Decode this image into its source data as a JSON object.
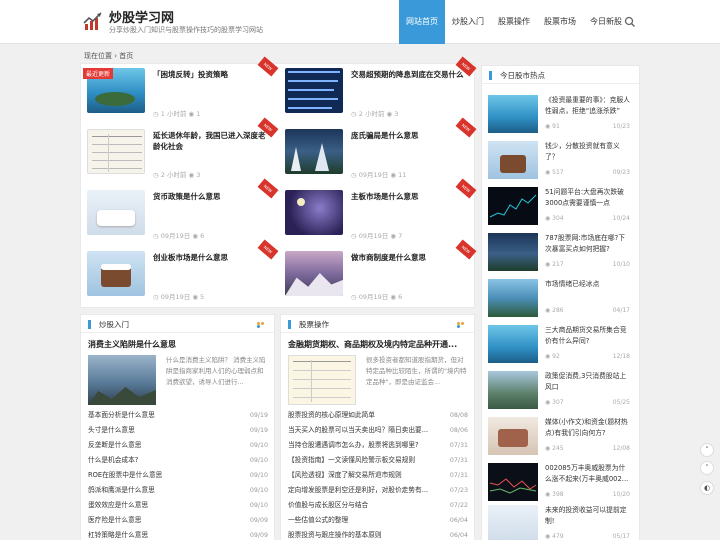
{
  "site": {
    "title": "炒股学习网",
    "subtitle": "分享炒股入门知识与股票操作技巧的股票学习网站"
  },
  "nav": [
    "网站首页",
    "炒股入门",
    "股票操作",
    "股票市场",
    "今日新股"
  ],
  "breadcrumb": "现在位置 › 首页",
  "ribbon": "NEW",
  "latest_tag": "最近更新",
  "cards": [
    {
      "title": "「困境反转」投资策略",
      "time": "1 小时前",
      "views": "1"
    },
    {
      "title": "交易超预期的降息到底在交易什么",
      "time": "2 小时前",
      "views": "3"
    },
    {
      "title": "延长退休年龄，我国已进入深度老龄化社会",
      "time": "2 小时前",
      "views": "3"
    },
    {
      "title": "庞氏骗局是什么意思",
      "time": "09月19日",
      "views": "11"
    },
    {
      "title": "货币政策是什么意思",
      "time": "09月19日",
      "views": "6"
    },
    {
      "title": "主板市场是什么意思",
      "time": "09月19日",
      "views": "7"
    },
    {
      "title": "创业板市场是什么意思",
      "time": "09月19日",
      "views": "5"
    },
    {
      "title": "做市商制度是什么意思",
      "time": "09月19日",
      "views": "6"
    }
  ],
  "section_left": {
    "label": "炒股入门",
    "featured_title": "消费主义陷阱是什么意思",
    "featured_desc": "什么是消费主义陷阱？ 消费主义陷阱是指商家利用人们的心理弱点和消费欲望，诱导人们进行...",
    "items": [
      {
        "t": "基本面分析是什么意思",
        "d": "09/19"
      },
      {
        "t": "头寸是什么意思",
        "d": "09/19"
      },
      {
        "t": "反垄断是什么意思",
        "d": "09/10"
      },
      {
        "t": "什么是机会成本?",
        "d": "09/10"
      },
      {
        "t": "ROE在股票中是什么意思",
        "d": "09/10"
      },
      {
        "t": "鸽派和鹰派是什么意思",
        "d": "09/10"
      },
      {
        "t": "蛋效效应是什么意思",
        "d": "09/10"
      },
      {
        "t": "医疗险是什么意思",
        "d": "09/09"
      },
      {
        "t": "杠铃策略是什么意思",
        "d": "09/09"
      }
    ]
  },
  "section_right": {
    "label": "股票操作",
    "featured_title": "金融期货期权、商品期权及境内特定品种开通...",
    "featured_desc": "很多投资者都知道股指期货，但对特定品种比较陌生，所谓的\"境内特定品种\"，即是由证监会...",
    "items": [
      {
        "t": "股票投资的核心原理如此简单",
        "d": "08/08"
      },
      {
        "t": "当天买入的股票可以当天卖出吗？隔日卖出要...",
        "d": "08/06"
      },
      {
        "t": "当持仓股遭遇调市怎么办，股票将逃到哪里?",
        "d": "07/31"
      },
      {
        "t": "【投资指南】一文读懂风险警示板交易规则",
        "d": "07/31"
      },
      {
        "t": "【风险透视】深度了解交易所退市规则",
        "d": "07/31"
      },
      {
        "t": "定向增发股票是利空还是利好，对股价走势有...",
        "d": "07/23"
      },
      {
        "t": "价值股与成长股区分与结合",
        "d": "07/22"
      },
      {
        "t": "一些估值公式的整理",
        "d": "06/04"
      },
      {
        "t": "股票投资与跟庄操作的基本原则",
        "d": "06/04"
      }
    ]
  },
  "sidebar": {
    "label": "今日股市热点",
    "items": [
      {
        "t": "《投资最重要的事》：克服人性弱点，拒绝“追涨杀跌”",
        "v": "91",
        "d": "10/23"
      },
      {
        "t": "钱少，分散投资就有意义了？",
        "v": "517",
        "d": "09/23"
      },
      {
        "t": "51问题平台:大盘再次跌破3000点需要谨慎一点",
        "v": "304",
        "d": "10/24"
      },
      {
        "t": "787股票网:市场底在哪?下次暴富买点如何把握?",
        "v": "217",
        "d": "10/10"
      },
      {
        "t": "市场情绪已经冰点",
        "v": "286",
        "d": "04/17"
      },
      {
        "t": "三大商品期货交易所集合竞价有什么异同?",
        "v": "92",
        "d": "12/18"
      },
      {
        "t": "政策促消费,3只消费股站上风口",
        "v": "307",
        "d": "05/25"
      },
      {
        "t": "媒体(小作文)和资金(题材热点)有我们引向何方?",
        "v": "245",
        "d": "12/08"
      },
      {
        "t": "002085万丰奥威股票为什么涨不起来(万丰奥威002...",
        "v": "398",
        "d": "10/20"
      },
      {
        "t": "未来的投资收益可以提前定制!",
        "v": "479",
        "d": "05/17"
      }
    ]
  },
  "colors": {
    "accent": "#3a9ad9",
    "ribbon": "#d9342b",
    "tag": "#e53935"
  }
}
